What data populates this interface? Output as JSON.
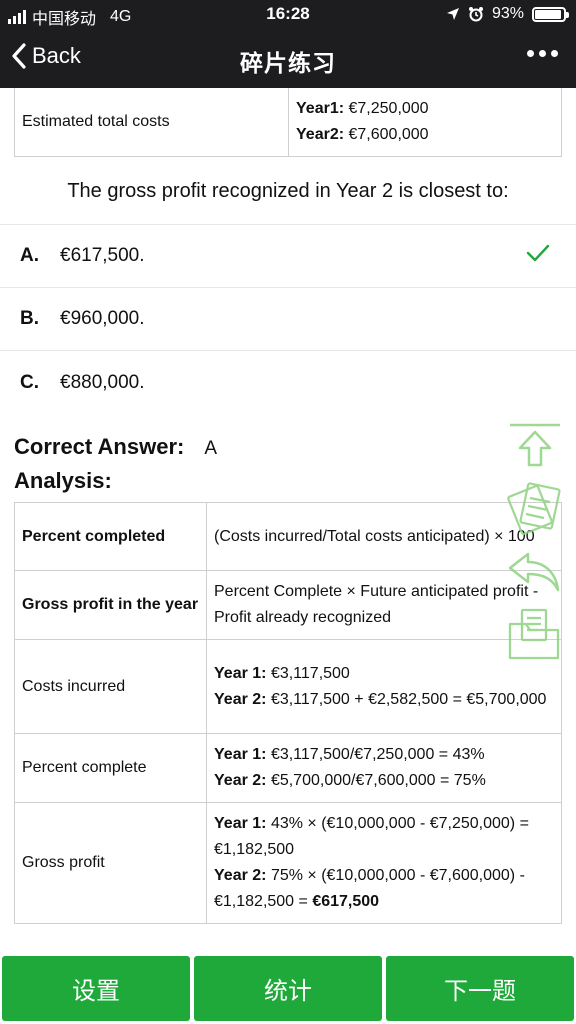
{
  "status_bar": {
    "carrier": "中国移动",
    "network": "4G",
    "time": "16:28",
    "battery": "93%",
    "battery_level": 0.93
  },
  "nav": {
    "back_label": "Back",
    "title": "碎片练习"
  },
  "top_table": {
    "label": "Estimated total costs",
    "year1_label": "Year1:",
    "year1_value": "€7,250,000",
    "year2_label": "Year2:",
    "year2_value": "€7,600,000"
  },
  "question": "The gross profit recognized in Year 2 is closest to:",
  "options": [
    {
      "letter": "A.",
      "text": "€617,500.",
      "correct": true
    },
    {
      "letter": "B.",
      "text": "€960,000."
    },
    {
      "letter": "C.",
      "text": "€880,000."
    }
  ],
  "answer": {
    "label": "Correct Answer:",
    "value": "A",
    "analysis_label": "Analysis:"
  },
  "analysis": {
    "rows": [
      {
        "h": "Percent completed",
        "v": "(Costs incurred/Total costs anticipated) × 100"
      },
      {
        "h": "Gross profit in the year",
        "v": "Percent Complete × Future anticipated profit - Profit already recognized"
      },
      {
        "h": "Costs incurred",
        "y1_label": "Year 1:",
        "y1": "€3,117,500",
        "y2_label": "Year 2:",
        "y2": "€3,117,500 + €2,582,500 = €5,700,000"
      },
      {
        "h": "Percent complete",
        "y1_label": "Year 1:",
        "y1": "€3,117,500/€7,250,000 = 43%",
        "y2_label": "Year 2:",
        "y2": "€5,700,000/€7,600,000 = 75%"
      },
      {
        "h": "Gross profit",
        "y1_label": "Year 1:",
        "y1": "43% × (€10,000,000 - €7,250,000) = €1,182,500",
        "y2_label": "Year 2:",
        "y2": "75% × (€10,000,000 - €7,600,000) - €1,182,500 = ",
        "y2_bold": "€617,500"
      }
    ]
  },
  "bottom_bar": {
    "settings": "设置",
    "stats": "统计",
    "next": "下一题"
  },
  "colors": {
    "accent_green": "#1fa93b",
    "check_green": "#22a83a",
    "floating_icon_green": "#8fd27f",
    "topbar": "#1d1d1f"
  },
  "icons": [
    "back-chevron-icon",
    "more-icon",
    "check-icon",
    "scroll-top-icon",
    "notes-icon",
    "undo-icon",
    "folder-icon",
    "location-arrow-icon",
    "alarm-icon"
  ]
}
